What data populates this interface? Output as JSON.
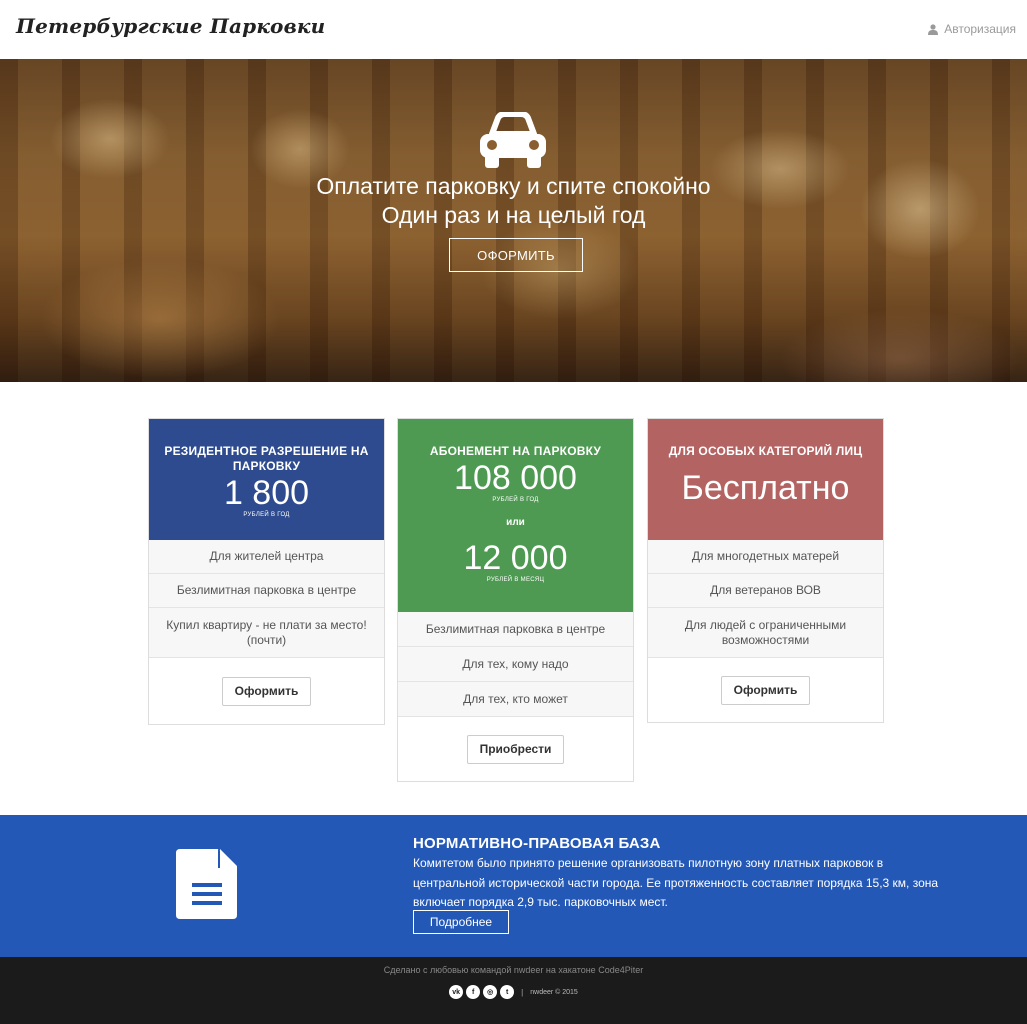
{
  "header": {
    "brand": "Петербургские Парковки",
    "login_label": "Авторизация",
    "login_icon": "user-icon"
  },
  "hero": {
    "icon": "car-icon",
    "line1": "Оплатите парковку и спите спокойно",
    "line2": "Один раз и на целый год",
    "button_label": "ОФОРМИТЬ"
  },
  "cards": [
    {
      "title": "РЕЗИДЕНТНОЕ РАЗРЕШЕНИЕ НА ПАРКОВКУ",
      "price": "1 800",
      "unit": "РУБЛЕЙ В ГОД",
      "color": "#2d4b8e",
      "features": [
        "Для жителей центра",
        "Безлимитная парковка в центре",
        "Купил квартиру - не плати за место! (почти)"
      ],
      "button_label": "Оформить"
    },
    {
      "title": "АБОНЕМЕНТ НА ПАРКОВКУ",
      "price": "108 000",
      "unit": "РУБЛЕЙ В ГОД",
      "or_label": "или",
      "price2": "12 000",
      "unit2": "РУБЛЕЙ В МЕСЯЦ",
      "color": "#4f9a52",
      "features": [
        "Безлимитная парковка в центре",
        "Для тех, кому надо",
        "Для тех, кто может"
      ],
      "button_label": "Приобрести"
    },
    {
      "title": "ДЛЯ ОСОБЫХ КАТЕГОРИЙ ЛИЦ",
      "price": "Бесплатно",
      "color": "#b36362",
      "features": [
        "Для многодетных матерей",
        "Для ветеранов ВОВ",
        "Для людей с ограниченными возможностями"
      ],
      "button_label": "Оформить"
    }
  ],
  "legal": {
    "icon": "document-icon",
    "title": "НОРМАТИВНО-ПРАВОВАЯ БАЗА",
    "text": "Комитетом было принято решение организовать пилотную зону платных парковок в центральной исторической части города. Ее протяженность составляет порядка 15,3 км, зона включает порядка 2,9 тыс. парковочных мест.",
    "button_label": "Подробнее",
    "background": "#2358b7"
  },
  "footer": {
    "made_by": "Сделано с любовью командой nwdeer на хакатоне Code4Piter",
    "social": [
      {
        "icon": "vk-icon",
        "glyph": "vk"
      },
      {
        "icon": "facebook-icon",
        "glyph": "f"
      },
      {
        "icon": "instagram-icon",
        "glyph": "◎"
      },
      {
        "icon": "twitter-icon",
        "glyph": "t"
      }
    ],
    "separator": "|",
    "copyright": "nwdeer © 2015"
  }
}
